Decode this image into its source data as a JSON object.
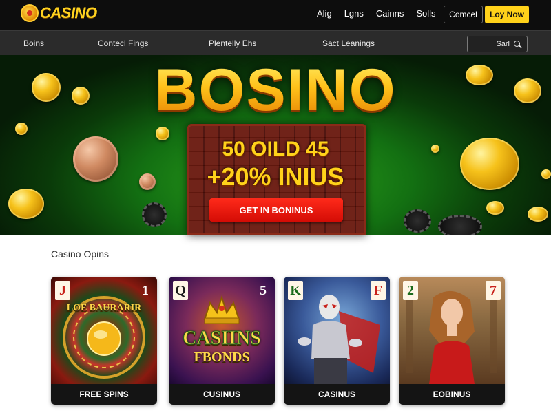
{
  "header": {
    "logo_text": "CASINO",
    "links": [
      "Alig",
      "Lgns",
      "Cainns",
      "Solls"
    ],
    "cancel_label": "Comcel",
    "buy_label": "Loy Now",
    "accent": "#ffd21a"
  },
  "nav": {
    "items": [
      "Boins",
      "Contecl Fings",
      "Plentelly Ehs",
      "Sact Leanings"
    ],
    "search_placeholder": "Sarl",
    "search_icon": "search-icon"
  },
  "hero": {
    "title": "BOSINO",
    "promo_line1": "50 OILD 45",
    "promo_line2": "+20% INIUS",
    "cta_label": "GET IN BONINUS",
    "cta_color": "#e8130a"
  },
  "games": {
    "section_title": "Casino Opins",
    "cards": [
      {
        "label": "FREE SPINS",
        "corner_left": "J",
        "corner_right": "1",
        "art_title": "LOE BAURARIR"
      },
      {
        "label": "CUSINUS",
        "corner_left": "Q",
        "corner_right": "5",
        "art_title": "CASIINS",
        "art_subtitle": "FBONDS"
      },
      {
        "label": "CASINUS",
        "corner_left": "K",
        "corner_right": "F",
        "art_title": ""
      },
      {
        "label": "EOBINUS",
        "corner_left": "2",
        "corner_right": "7",
        "art_title": ""
      }
    ]
  }
}
